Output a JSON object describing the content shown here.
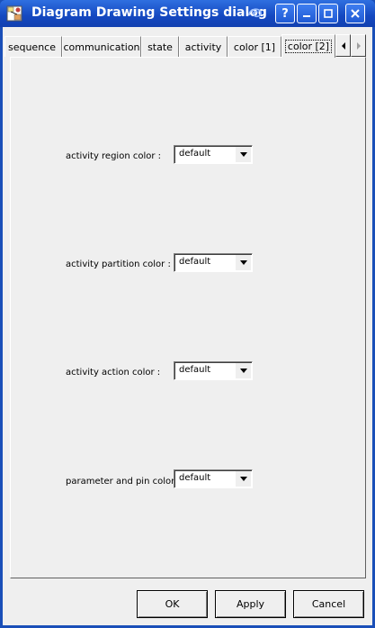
{
  "window": {
    "title": "Diagram Drawing Settings dialog",
    "help_label": "?",
    "minimize_label": "_",
    "maximize_label": "□",
    "close_label": "✕"
  },
  "tabs": [
    {
      "label": "sequence",
      "active": false
    },
    {
      "label": "communication",
      "active": false
    },
    {
      "label": "state",
      "active": false
    },
    {
      "label": "activity",
      "active": false
    },
    {
      "label": "color [1]",
      "active": false
    },
    {
      "label": "color [2]",
      "active": true
    }
  ],
  "tab_scroll": {
    "left": "◀",
    "right": "▶"
  },
  "fields": [
    {
      "label": "activity region color :",
      "value": "default"
    },
    {
      "label": "activity partition color :",
      "value": "default"
    },
    {
      "label": "activity action color :",
      "value": "default"
    },
    {
      "label": "parameter and pin color :",
      "value": "default"
    }
  ],
  "buttons": {
    "ok": "OK",
    "apply": "Apply",
    "cancel": "Cancel"
  }
}
